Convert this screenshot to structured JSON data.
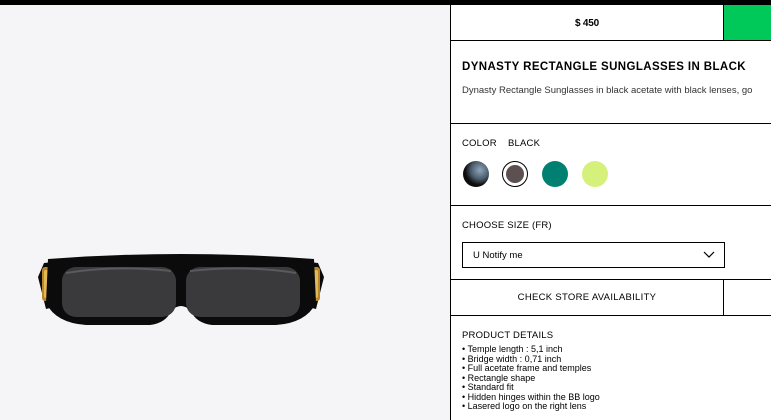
{
  "gallery": {
    "image_icon": "sunglasses-image"
  },
  "header": {
    "price": "$ 450"
  },
  "product": {
    "title": "DYNASTY RECTANGLE SUNGLASSES IN BLACK",
    "description": "Dynasty Rectangle Sunglasses in black acetate with black lenses, go"
  },
  "color": {
    "label": "COLOR",
    "selected": "BLACK",
    "swatch_colors": [
      "#4a5c6c",
      "#5c5050",
      "#008070",
      "#d6f07c"
    ]
  },
  "size": {
    "label": "CHOOSE SIZE (FR)",
    "selected_option": "U Notify me"
  },
  "store": {
    "button_label": "CHECK STORE AVAILABILITY"
  },
  "details": {
    "label": "PRODUCT DETAILS",
    "items": [
      "Temple length : 5,1 inch",
      "Bridge width : 0,71 inch",
      "Full acetate frame and temples",
      "Rectangle shape",
      "Standard fit",
      "Hidden hinges within the BB logo",
      "Lasered logo on the right lens"
    ]
  },
  "colors": {
    "buy_accent": "#00c95a",
    "gallery_bg": "#f5f5f7"
  }
}
